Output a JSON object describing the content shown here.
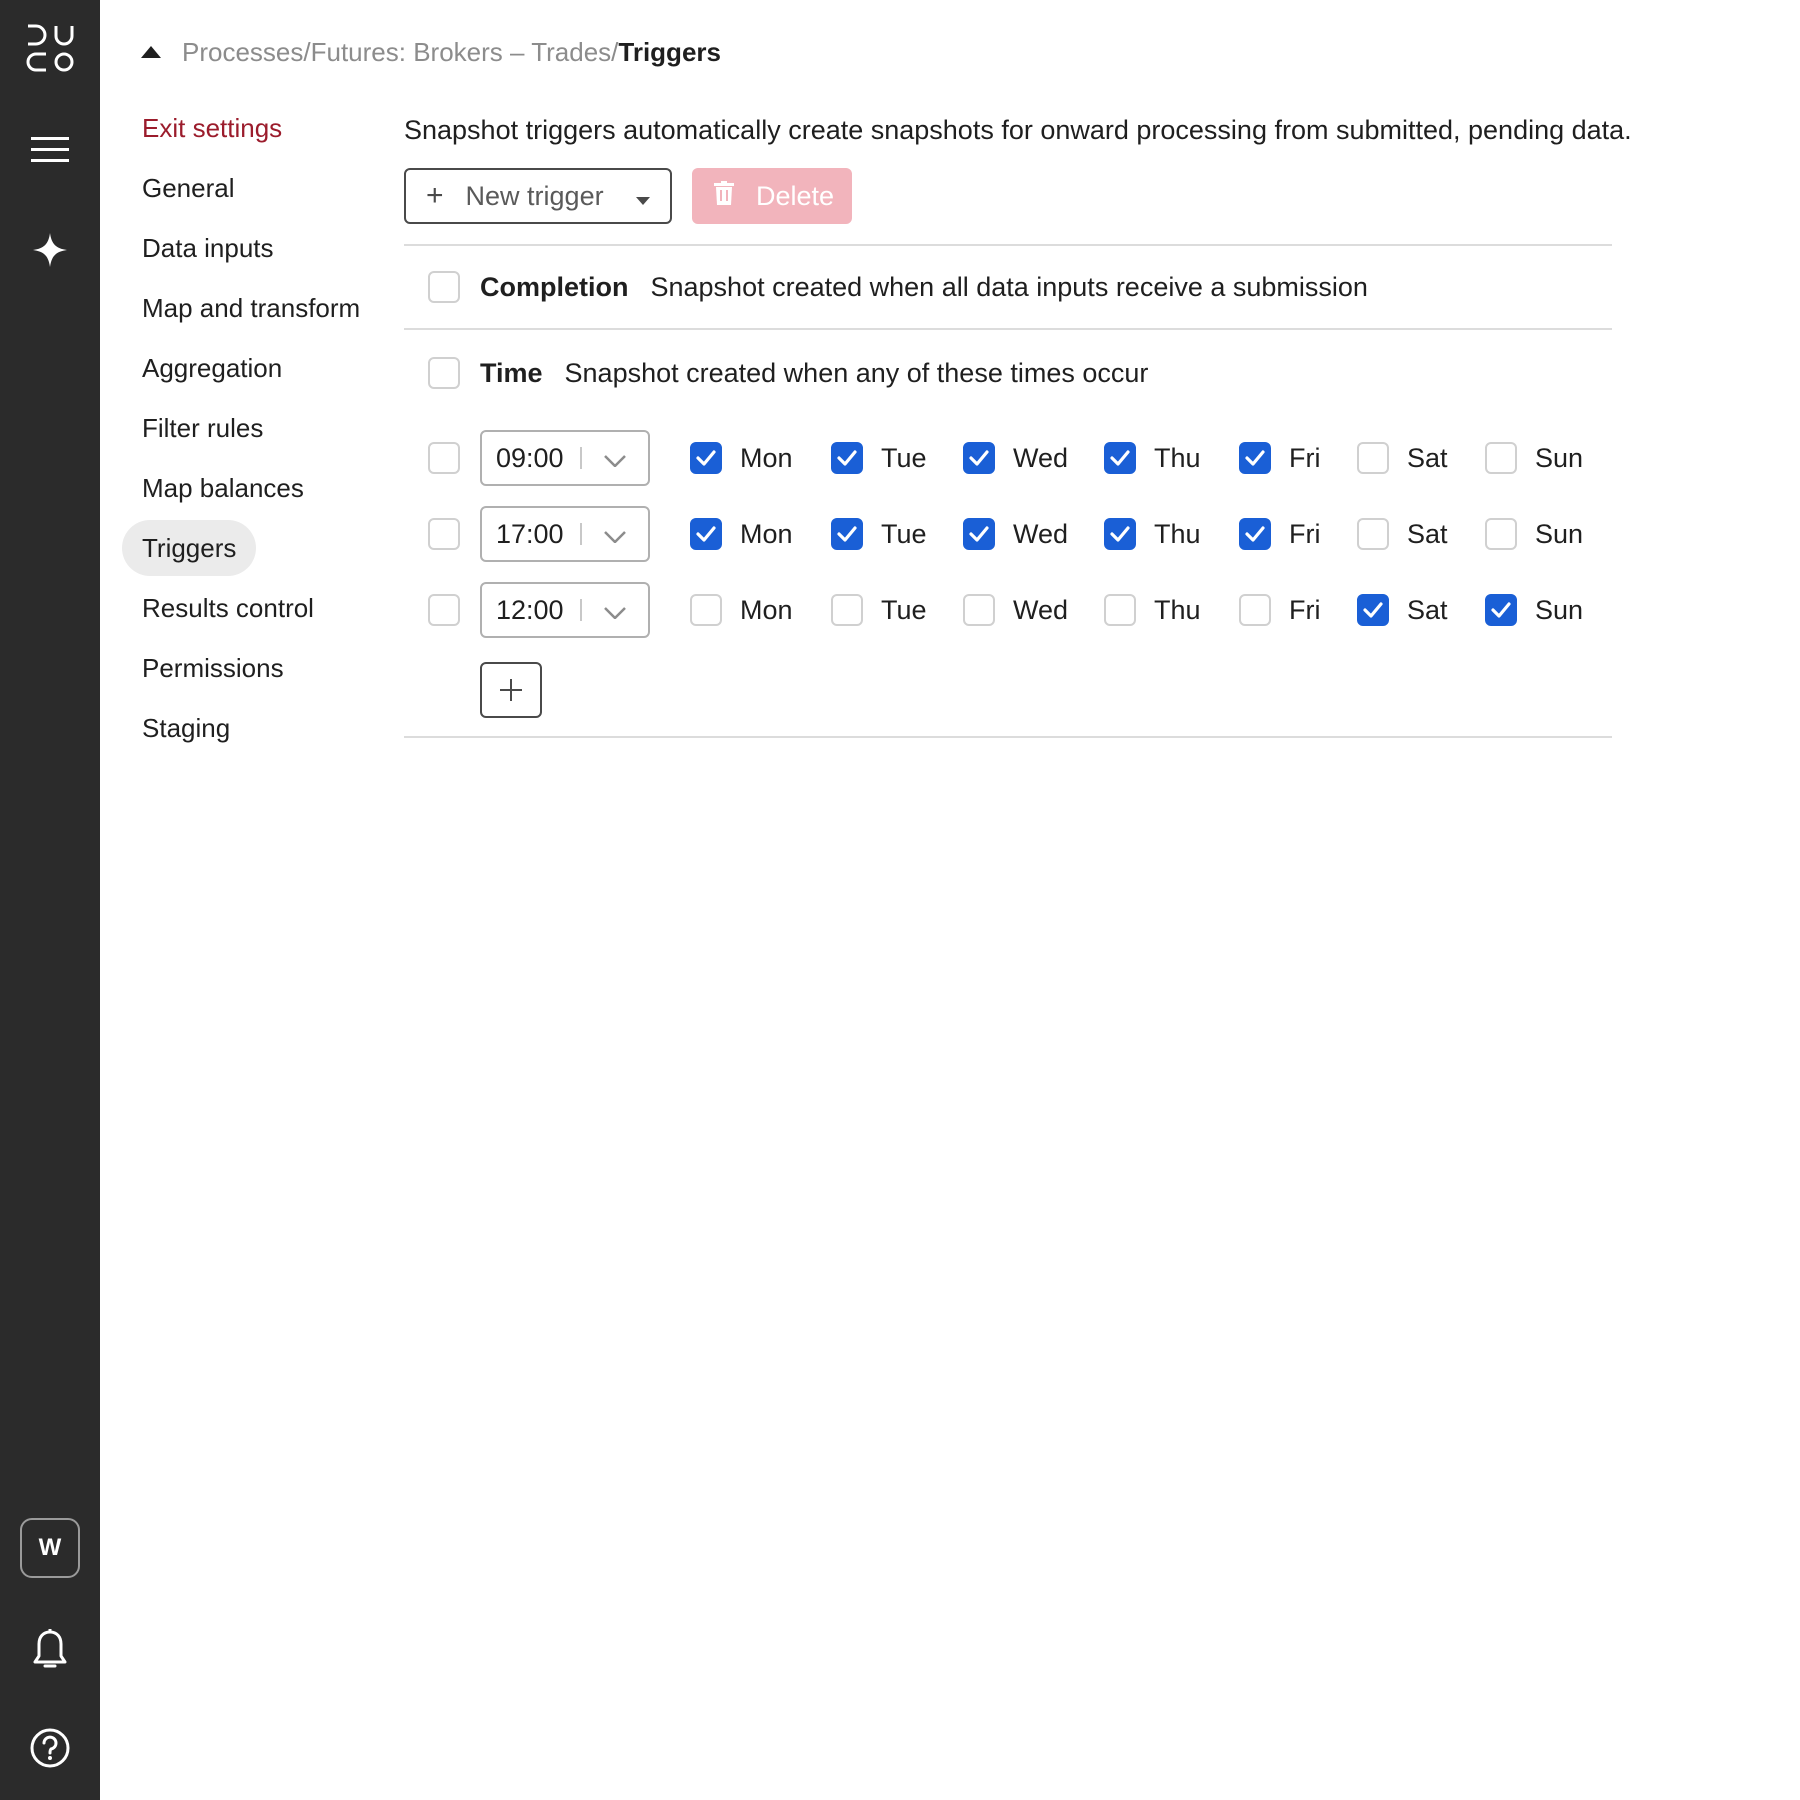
{
  "rail": {
    "logo_name": "duco-logo",
    "workspace_initial": "W",
    "icons": [
      "menu-icon",
      "sparkle-icon",
      "bell-icon",
      "help-icon"
    ]
  },
  "breadcrumb": {
    "path": "Processes/Futures: Brokers – Trades/",
    "current": "Triggers"
  },
  "nav": {
    "items": [
      {
        "label": "Exit settings"
      },
      {
        "label": "General"
      },
      {
        "label": "Data inputs"
      },
      {
        "label": "Map and transform"
      },
      {
        "label": "Aggregation"
      },
      {
        "label": "Filter rules"
      },
      {
        "label": "Map balances"
      },
      {
        "label": "Triggers"
      },
      {
        "label": "Results control"
      },
      {
        "label": "Permissions"
      },
      {
        "label": "Staging"
      }
    ],
    "active": "Triggers"
  },
  "main": {
    "intro": "Snapshot triggers automatically create snapshots for onward processing from submitted, pending data.",
    "new_trigger_label": "New trigger",
    "delete_label": "Delete",
    "completion": {
      "title": "Completion",
      "description": "Snapshot created when all data inputs receive a submission",
      "checked": false
    },
    "time": {
      "title": "Time",
      "description": "Snapshot created when any of these times occur",
      "checked": false,
      "rows": [
        {
          "time": "09:00",
          "days": [
            {
              "label": "Mon",
              "checked": true
            },
            {
              "label": "Tue",
              "checked": true
            },
            {
              "label": "Wed",
              "checked": true
            },
            {
              "label": "Thu",
              "checked": true
            },
            {
              "label": "Fri",
              "checked": true
            },
            {
              "label": "Sat",
              "checked": false
            },
            {
              "label": "Sun",
              "checked": false
            }
          ]
        },
        {
          "time": "17:00",
          "days": [
            {
              "label": "Mon",
              "checked": true
            },
            {
              "label": "Tue",
              "checked": true
            },
            {
              "label": "Wed",
              "checked": true
            },
            {
              "label": "Thu",
              "checked": true
            },
            {
              "label": "Fri",
              "checked": true
            },
            {
              "label": "Sat",
              "checked": false
            },
            {
              "label": "Sun",
              "checked": false
            }
          ]
        },
        {
          "time": "12:00",
          "days": [
            {
              "label": "Mon",
              "checked": false
            },
            {
              "label": "Tue",
              "checked": false
            },
            {
              "label": "Wed",
              "checked": false
            },
            {
              "label": "Thu",
              "checked": false
            },
            {
              "label": "Fri",
              "checked": false
            },
            {
              "label": "Sat",
              "checked": true
            },
            {
              "label": "Sun",
              "checked": true
            }
          ]
        }
      ]
    }
  },
  "colors": {
    "rail_bg": "#2b2b2b",
    "accent_blue": "#1a5fd6",
    "exit_red": "#9b1c2c",
    "delete_pink": "#f2b4bc"
  }
}
